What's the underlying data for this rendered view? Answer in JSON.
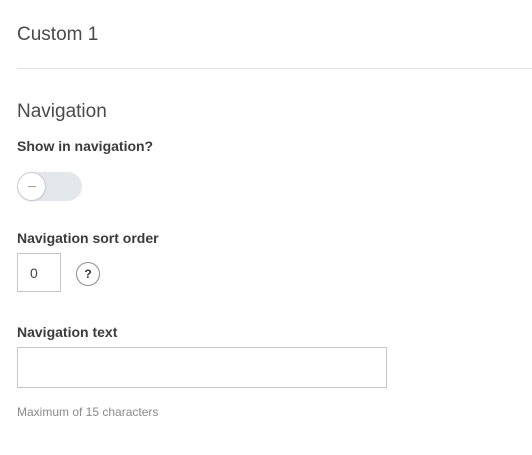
{
  "section": {
    "title": "Custom 1"
  },
  "navigation": {
    "heading": "Navigation",
    "show_label": "Show in navigation?",
    "show_toggle": {
      "enabled": false,
      "icon": "minus-icon"
    },
    "sort_order_label": "Navigation sort order",
    "sort_order_value": "0",
    "help_icon": "?",
    "text_label": "Navigation text",
    "text_value": "",
    "text_hint": "Maximum of 15 characters"
  },
  "colors": {
    "toggle_off_bg": "#e3e6ea",
    "text": "#3b3b3b",
    "hint": "#8a8a8a",
    "divider": "#e3e3e3"
  }
}
